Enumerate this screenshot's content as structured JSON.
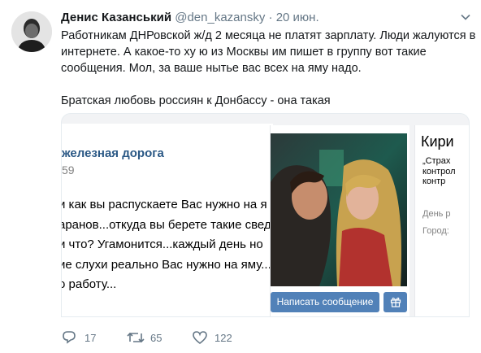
{
  "tweet": {
    "author_name": "Денис Казанський",
    "author_handle": "@den_kazansky",
    "separator": "·",
    "date": "20 июн.",
    "text_lines": [
      "Работникам ДНРовской ж/д 2 месяца не платят зарплату. Люди жалуются в",
      "интернете. А какое-то ху   ю из Москвы им пишет в группу вот такие",
      "сообщения. Мол, за ваше нытье вас всех на яму надо."
    ],
    "text_line_final": "Братская любовь россиян к Донбассу - она такая",
    "replies": "17",
    "retweets": "65",
    "likes": "122",
    "icons": {
      "reply": "reply-icon",
      "retweet": "retweet-icon",
      "like": "heart-icon",
      "menu": "chevron-down-icon"
    }
  },
  "screenshot": {
    "group_name": "железная дорога",
    "group_sub": "59",
    "message_lines": [
      "и как вы распускаете Вас нужно на я",
      "аранов...откуда вы берете такие свед",
      "и что? Угамонится...каждый день но",
      "ие слухи реально Вас нужно на яму...",
      "о работу..."
    ],
    "profile": {
      "write_message_button": "Написать сообщение",
      "name": "Кири",
      "status_lines": [
        "„Страх",
        "контрол",
        "контр"
      ],
      "birthday_label": "День р",
      "city_label": "Город:"
    }
  },
  "colors": {
    "vk_blue": "#5181b8",
    "vk_link": "#2a5885",
    "twitter_grey": "#657786"
  }
}
